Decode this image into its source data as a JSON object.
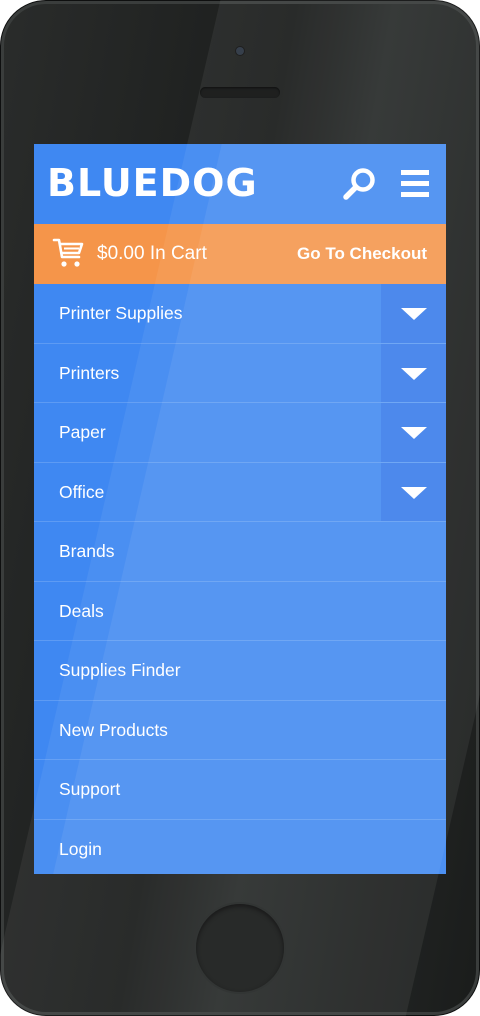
{
  "brand": {
    "logo_text": "BLUEDOG"
  },
  "header": {
    "search_icon": "search-icon",
    "menu_icon": "hamburger-menu-icon"
  },
  "cart": {
    "icon": "shopping-cart-icon",
    "summary": "$0.00 In Cart",
    "checkout_label": "Go To Checkout"
  },
  "menu": {
    "items": [
      {
        "label": "Printer Supplies",
        "expandable": true
      },
      {
        "label": "Printers",
        "expandable": true
      },
      {
        "label": "Paper",
        "expandable": true
      },
      {
        "label": "Office",
        "expandable": true
      },
      {
        "label": "Brands",
        "expandable": false
      },
      {
        "label": "Deals",
        "expandable": false
      },
      {
        "label": "Supplies Finder",
        "expandable": false
      },
      {
        "label": "New Products",
        "expandable": false
      },
      {
        "label": "Support",
        "expandable": false
      },
      {
        "label": "Login",
        "expandable": false
      }
    ]
  },
  "colors": {
    "primary": "#3f88f2",
    "expander": "#3479ea",
    "cart_bar": "#f5954a",
    "text": "#ffffff",
    "device": "#1f2120"
  }
}
